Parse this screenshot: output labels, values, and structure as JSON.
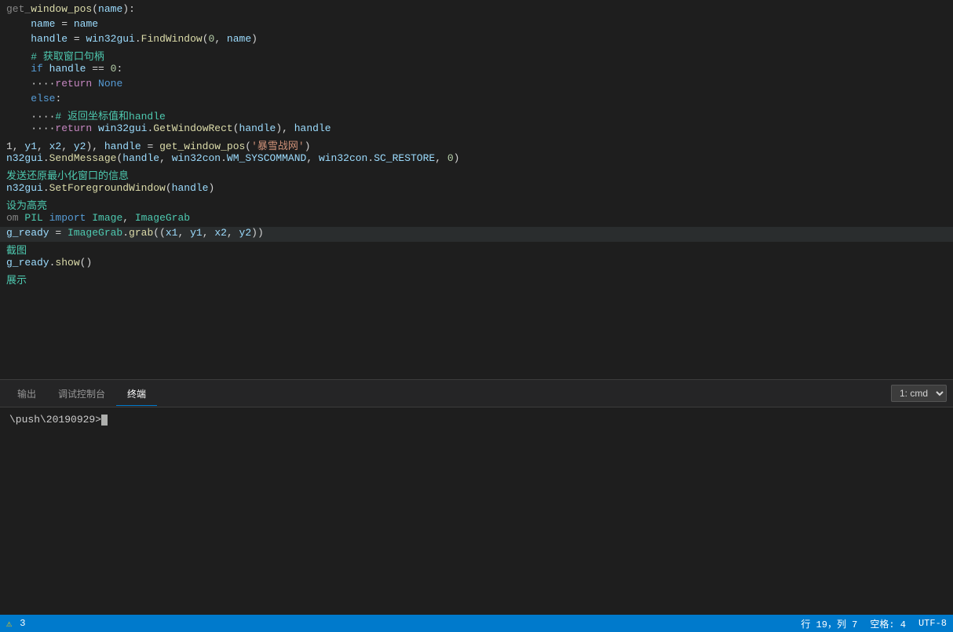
{
  "editor": {
    "lines": [
      {
        "id": 1,
        "indent": "",
        "content": "get_window_pos(name):",
        "type": "comment-partial",
        "highlighted": false
      },
      {
        "id": 2,
        "indent": "    ",
        "content": "name = name",
        "type": "normal",
        "highlighted": false
      },
      {
        "id": 3,
        "indent": "    ",
        "content": "handle = win32gui.FindWindow(0, name)",
        "type": "normal",
        "highlighted": false
      },
      {
        "id": 4,
        "indent": "    ",
        "content": "# 获取窗口句柄",
        "type": "comment-zh",
        "highlighted": false
      },
      {
        "id": 5,
        "indent": "    ",
        "content": "if handle == 0:",
        "type": "kw",
        "highlighted": false
      },
      {
        "id": 6,
        "indent": "        ",
        "content": "return None",
        "type": "return",
        "highlighted": false
      },
      {
        "id": 7,
        "indent": "    ",
        "content": "else:",
        "type": "kw-plain",
        "highlighted": false
      },
      {
        "id": 8,
        "indent": "        ",
        "content": "# 返回坐标值和handle",
        "type": "comment-zh",
        "highlighted": false
      },
      {
        "id": 9,
        "indent": "        ",
        "content": "return win32gui.GetWindowRect(handle), handle",
        "type": "return-fn",
        "highlighted": false
      },
      {
        "id": 10,
        "indent": "",
        "content": "1, y1, x2, y2), handle = get_window_pos('暴雪战网')",
        "type": "normal",
        "highlighted": false
      },
      {
        "id": 11,
        "indent": "",
        "content": "n32gui.SendMessage(handle, win32con.WM_SYSCOMMAND, win32con.SC_RESTORE, 0)",
        "type": "normal",
        "highlighted": false
      },
      {
        "id": 12,
        "indent": "",
        "content": "发送还原最小化窗口的信息",
        "type": "comment-zh",
        "highlighted": false
      },
      {
        "id": 13,
        "indent": "",
        "content": "n32gui.SetForegroundWindow(handle)",
        "type": "normal",
        "highlighted": false
      },
      {
        "id": 14,
        "indent": "",
        "content": "设为高亮",
        "type": "comment-zh",
        "highlighted": false
      },
      {
        "id": 15,
        "indent": "",
        "content": "om PIL import Image, ImageGrab",
        "type": "import",
        "highlighted": false
      },
      {
        "id": 16,
        "indent": "",
        "content": "g_ready = ImageGrab.grab((x1, y1, x2, y2))",
        "type": "normal",
        "highlighted": true
      },
      {
        "id": 17,
        "indent": "",
        "content": "截图",
        "type": "comment-zh",
        "highlighted": false
      },
      {
        "id": 18,
        "indent": "",
        "content": "g_ready.show()",
        "type": "normal",
        "highlighted": false
      },
      {
        "id": 19,
        "indent": "",
        "content": "展示",
        "type": "comment-zh",
        "highlighted": false
      }
    ]
  },
  "panel": {
    "tabs": [
      {
        "label": "输出",
        "active": false
      },
      {
        "label": "调试控制台",
        "active": false
      },
      {
        "label": "终端",
        "active": true
      }
    ],
    "terminal_select": "1: cmd",
    "terminal_path": "\\push\\20190929>"
  },
  "statusbar": {
    "warnings": "3",
    "position": "行 19，列 7",
    "spaces": "空格: 4",
    "encoding": "UTF-8"
  }
}
